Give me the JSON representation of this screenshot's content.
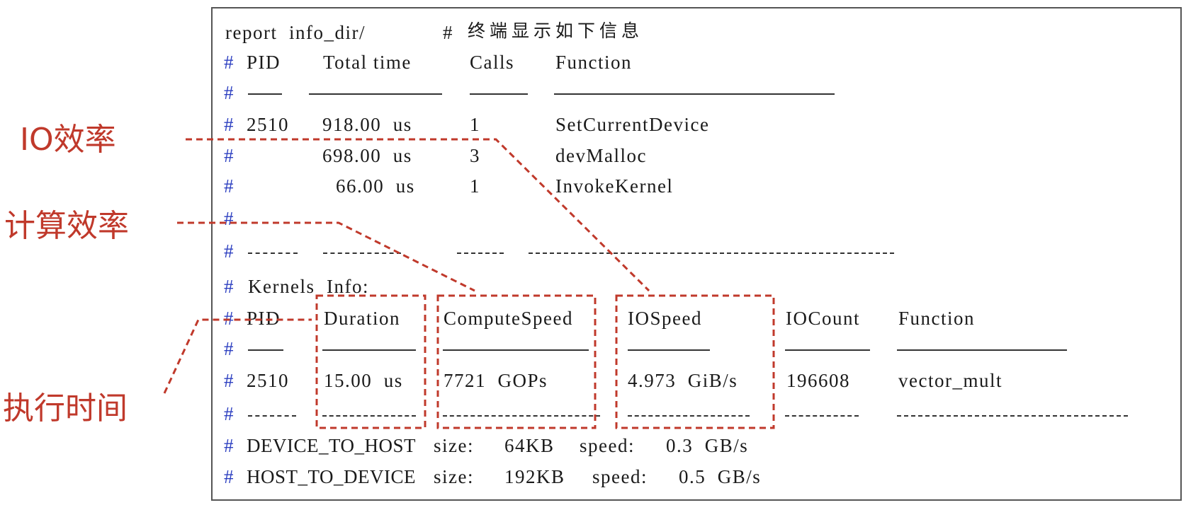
{
  "header": {
    "command": "report  info_dir/",
    "comment_hash": "#",
    "comment_text": "终端显示如下信息"
  },
  "hash": "#",
  "functions_table": {
    "headers": [
      "PID",
      "Total time",
      "Calls",
      "Function"
    ],
    "rows": [
      {
        "pid": "2510",
        "time": "918.00  us",
        "calls": "1",
        "function": "SetCurrentDevice"
      },
      {
        "pid": "",
        "time": "698.00  us",
        "calls": "3",
        "function": "devMalloc"
      },
      {
        "pid": "",
        "time": "66.00  us",
        "calls": "1",
        "function": "InvokeKernel"
      }
    ]
  },
  "kernels_info_label": "Kernels  Info:",
  "kernels_table": {
    "headers": [
      "PID",
      "Duration",
      "ComputeSpeed",
      "IOSpeed",
      "IOCount",
      "Function"
    ],
    "row": {
      "pid": "2510",
      "duration": "15.00  us",
      "compute_speed": "7721  GOPs",
      "io_speed": "4.973  GiB/s",
      "io_count": "196608",
      "function": "vector_mult"
    }
  },
  "transfers": [
    {
      "direction": "DEVICE_TO_HOST",
      "size_label": "size:",
      "size": "64KB",
      "speed_label": "speed:",
      "speed": "0.3  GB/s"
    },
    {
      "direction": "HOST_TO_DEVICE",
      "size_label": "size:",
      "size": "192KB",
      "speed_label": "speed:",
      "speed": "0.5  GB/s"
    }
  ],
  "annotations": {
    "io_efficiency": "IO效率",
    "compute_efficiency": "计算效率",
    "execution_time": "执行时间"
  },
  "colors": {
    "annotation": "#c0392b",
    "hash": "#2c3fc0",
    "border": "#555555"
  }
}
